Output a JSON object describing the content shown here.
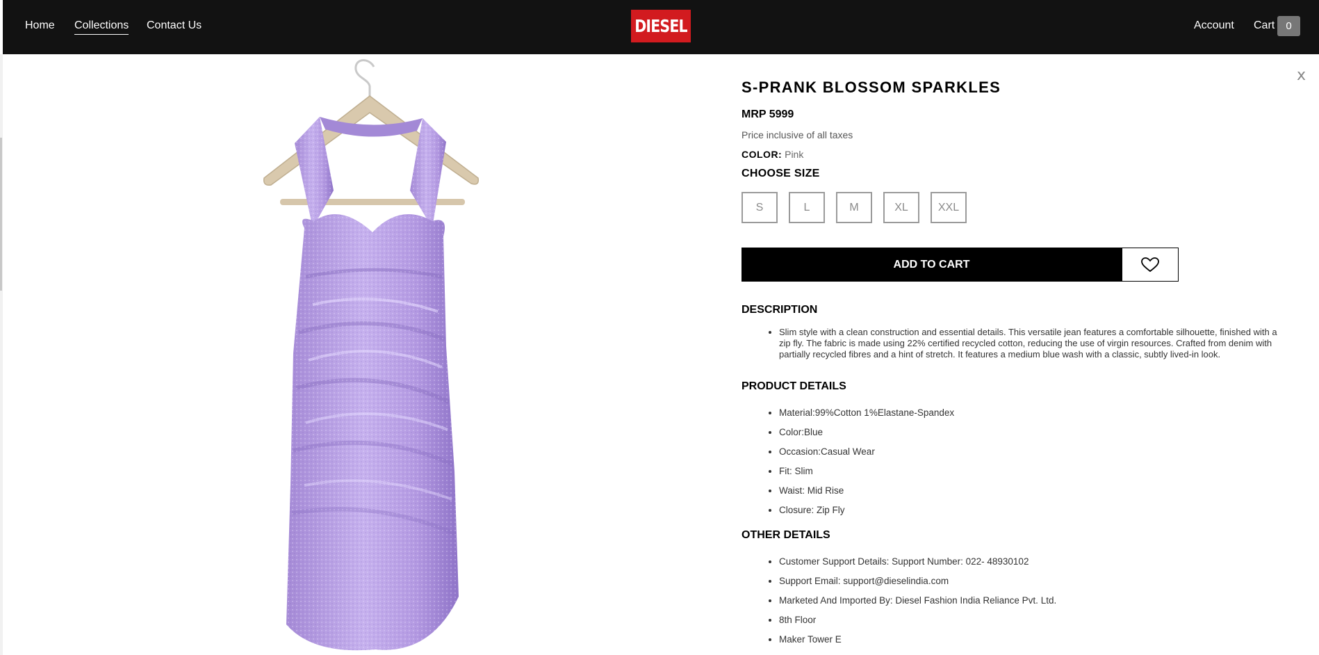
{
  "nav": {
    "home": "Home",
    "collections": "Collections",
    "contact": "Contact Us",
    "account": "Account",
    "cart": "Cart",
    "cart_count": "0"
  },
  "brand": {
    "logo_text": "DIESEL",
    "logo_color": "#d21b1f"
  },
  "product": {
    "title": "S-PRANK BLOSSOM SPARKLES",
    "mrp": "MRP 5999",
    "tax_note": "Price inclusive of all taxes",
    "color_label": "COLOR:",
    "color_value": "Pink",
    "choose_size": "CHOOSE SIZE",
    "sizes": [
      "S",
      "L",
      "M",
      "XL",
      "XXL"
    ],
    "add_to_cart": "ADD TO CART",
    "close": "x"
  },
  "description": {
    "heading": "DESCRIPTION",
    "text": "Slim style with a clean construction and essential details. This versatile jean features a comfortable silhouette, finished with a zip fly. The fabric is made using 22% certified recycled cotton, reducing the use of virgin resources. Crafted from denim with partially recycled fibres and a hint of stretch. It features a medium blue wash with a classic, subtly lived-in look."
  },
  "product_details": {
    "heading": "PRODUCT DETAILS",
    "items": [
      "Material:99%Cotton 1%Elastane-Spandex",
      "Color:Blue",
      "Occasion:Casual Wear",
      "Fit: Slim",
      "Waist: Mid Rise",
      "Closure: Zip Fly"
    ]
  },
  "other_details": {
    "heading": "OTHER DETAILS",
    "items": [
      "Customer Support Details: Support Number: 022- 48930102",
      "Support Email: support@dieselindia.com",
      "Marketed And Imported By: Diesel Fashion India Reliance Pvt. Ltd.",
      "8th Floor",
      "Maker Tower E"
    ]
  },
  "icons": {
    "wishlist": "heart-icon",
    "close": "close-icon"
  },
  "colors": {
    "header_bg": "#121212",
    "button_bg": "#000000",
    "dress": "#b39ae0"
  }
}
